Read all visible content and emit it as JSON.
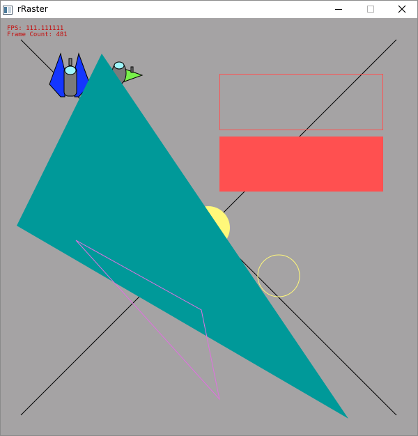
{
  "window": {
    "title": "rRaster",
    "icon": "app-window-icon",
    "controls": [
      "minimize-icon",
      "maximize-icon",
      "close-icon"
    ]
  },
  "overlay": {
    "fps_text": "FPS: 111.111111",
    "frame_count_text": "Frame Count: 481",
    "text_color": "#c50c0c"
  },
  "scene": {
    "background_color": "#a5a3a4",
    "line_color": "#000000",
    "triangle_fill_color": "#009999",
    "triangle_outline_color": "#e070e0",
    "rect_outline_color": "#ff5050",
    "rect_fill_color": "#ff5050",
    "circle_fill_color": "#fff87a",
    "circle_outline_color": "#fff87a",
    "sprites": [
      "blue-spaceship-sprite",
      "green-spaceship-sprite"
    ]
  }
}
